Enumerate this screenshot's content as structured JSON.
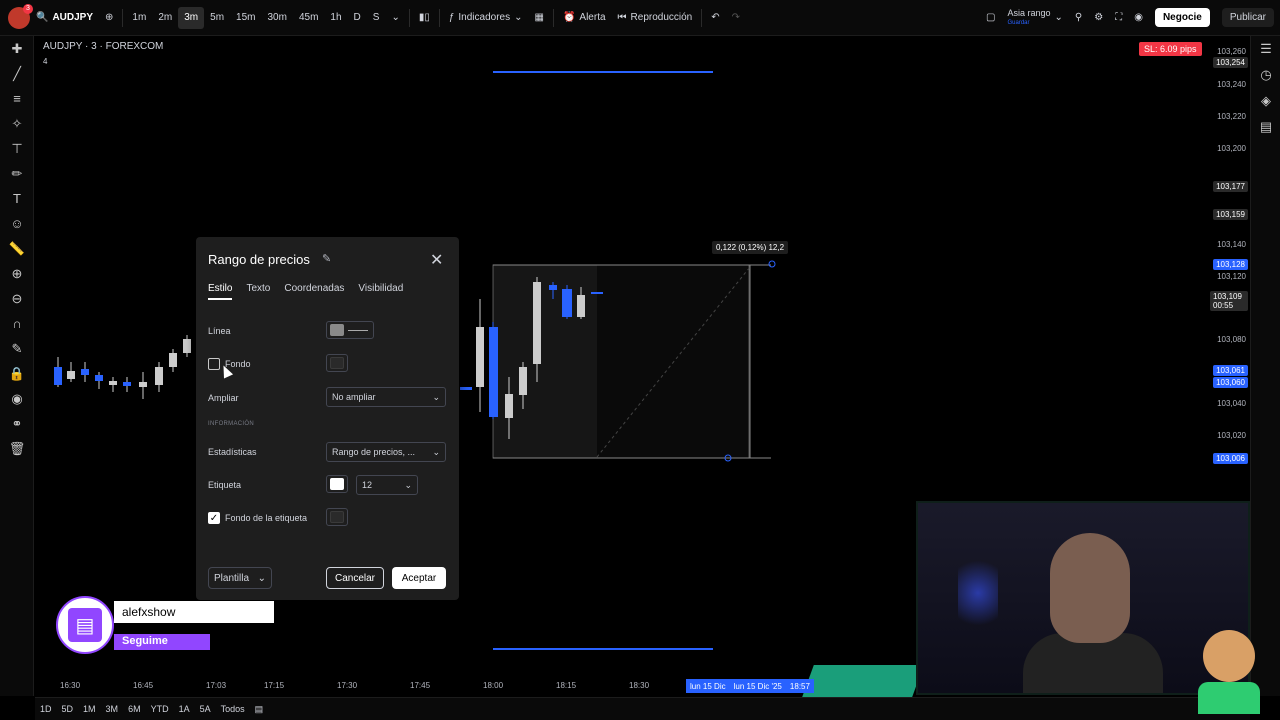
{
  "toolbar": {
    "notification_count": "3",
    "symbol": "AUDJPY",
    "timeframes": [
      "1m",
      "2m",
      "3m",
      "5m",
      "15m",
      "30m",
      "45m",
      "1h",
      "D",
      "S"
    ],
    "active_timeframe_index": 2,
    "indicators_label": "Indicadores",
    "alert_label": "Alerta",
    "replay_label": "Reproducción",
    "layout_name": "Asia rango",
    "layout_sub": "Guardar",
    "trade_label": "Negocie",
    "publish_label": "Publicar"
  },
  "chart": {
    "title": "AUDJPY · 3 · FOREXCOM",
    "indicator_count": "4",
    "sl_badge": "SL: 6.09 pips",
    "measure_label": "0,122 (0,12%) 12,2",
    "price_labels": [
      "103,260",
      "103,240",
      "103,220",
      "103,200",
      "103,159",
      "103,140",
      "103,120",
      "103,080",
      "103,040",
      "103,020"
    ],
    "price_tags": [
      {
        "text": "103,254",
        "color": "#2a2a2a"
      },
      {
        "text": "103,177",
        "color": "#2a2a2a"
      },
      {
        "text": "103,128",
        "color": "#2962ff"
      },
      {
        "text": "103,109 00:55",
        "color": "#2a2a2a"
      },
      {
        "text": "103,061",
        "color": "#2962ff"
      },
      {
        "text": "103,060",
        "color": "#2962ff"
      },
      {
        "text": "103,006",
        "color": "#2962ff"
      }
    ],
    "time_labels": [
      "16:30",
      "16:45",
      "17:03",
      "17:15",
      "17:30",
      "17:45",
      "18:00",
      "18:15",
      "18:30"
    ],
    "date_tag": [
      "lun 15 Dic",
      "lun 15 Dic '25",
      "18:57"
    ]
  },
  "bottom": {
    "ranges": [
      "1D",
      "5D",
      "1M",
      "3M",
      "6M",
      "YTD",
      "1A",
      "5A",
      "Todos"
    ]
  },
  "dialog": {
    "title": "Rango de precios",
    "tabs": [
      "Estilo",
      "Texto",
      "Coordenadas",
      "Visibilidad"
    ],
    "line_label": "Línea",
    "background_label": "Fondo",
    "extend_label": "Ampliar",
    "extend_value": "No ampliar",
    "info_header": "INFORMACIÓN",
    "stats_label": "Estadísticas",
    "stats_value": "Rango de precios, ...",
    "label_label": "Etiqueta",
    "label_size": "12",
    "label_bg_label": "Fondo de la etiqueta",
    "template_label": "Plantilla",
    "cancel_label": "Cancelar",
    "ok_label": "Aceptar",
    "line_color": "#8a8a8a",
    "background_checked": false,
    "label_bg_checked": true
  },
  "overlay": {
    "twitch_name": "alefxshow",
    "twitch_follow": "Seguime",
    "twitch_color": "#9146ff"
  }
}
